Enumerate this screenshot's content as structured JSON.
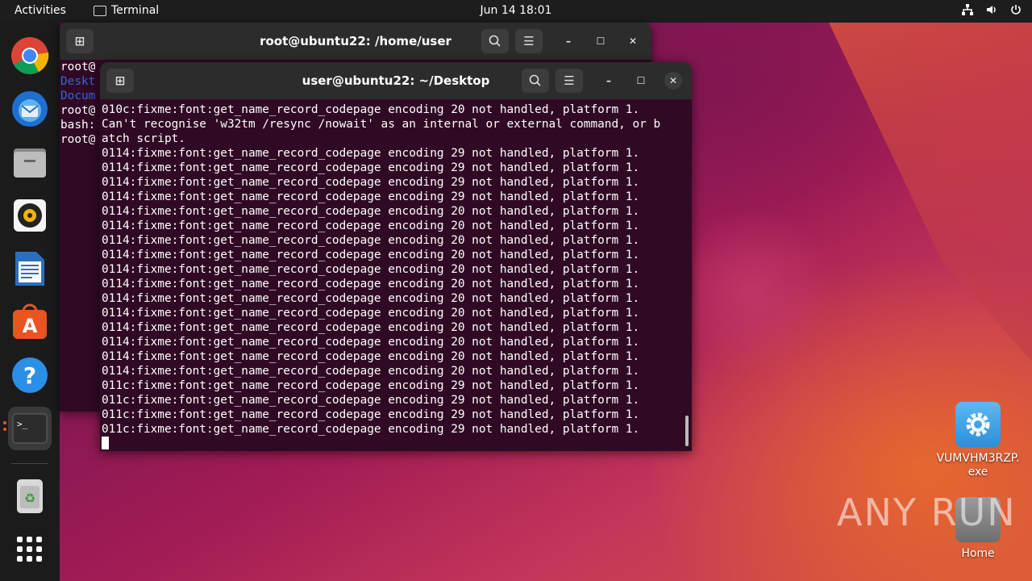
{
  "topbar": {
    "activities": "Activities",
    "app_name": "Terminal",
    "clock": "Jun 14  18:01",
    "tray_icons": [
      "network-icon",
      "volume-icon",
      "power-icon"
    ]
  },
  "dock": {
    "items": [
      "chrome-icon",
      "thunderbird-icon",
      "files-icon",
      "rhythmbox-icon",
      "writer-icon",
      "app-center-icon",
      "help-icon",
      "terminal-icon",
      "trash-icon",
      "show-apps-icon"
    ]
  },
  "back_window": {
    "title": "root@ubuntu22: /home/user",
    "lines": [
      {
        "text": "root@",
        "color": "#ffffff"
      },
      {
        "text": "Deskt",
        "color": "#3465d4"
      },
      {
        "text": "Docum",
        "color": "#3465d4"
      },
      {
        "text": "root@",
        "color": "#ffffff"
      },
      {
        "text": "bash:",
        "color": "#ffffff"
      },
      {
        "text": "root@",
        "color": "#ffffff"
      }
    ]
  },
  "front_window": {
    "title": "user@ubuntu22: ~/Desktop",
    "lines": [
      "010c:fixme:font:get_name_record_codepage encoding 20 not handled, platform 1.",
      "Can't recognise 'w32tm /resync /nowait' as an internal or external command, or b",
      "atch script.",
      "0114:fixme:font:get_name_record_codepage encoding 29 not handled, platform 1.",
      "0114:fixme:font:get_name_record_codepage encoding 29 not handled, platform 1.",
      "0114:fixme:font:get_name_record_codepage encoding 29 not handled, platform 1.",
      "0114:fixme:font:get_name_record_codepage encoding 29 not handled, platform 1.",
      "0114:fixme:font:get_name_record_codepage encoding 20 not handled, platform 1.",
      "0114:fixme:font:get_name_record_codepage encoding 20 not handled, platform 1.",
      "0114:fixme:font:get_name_record_codepage encoding 20 not handled, platform 1.",
      "0114:fixme:font:get_name_record_codepage encoding 20 not handled, platform 1.",
      "0114:fixme:font:get_name_record_codepage encoding 20 not handled, platform 1.",
      "0114:fixme:font:get_name_record_codepage encoding 20 not handled, platform 1.",
      "0114:fixme:font:get_name_record_codepage encoding 20 not handled, platform 1.",
      "0114:fixme:font:get_name_record_codepage encoding 20 not handled, platform 1.",
      "0114:fixme:font:get_name_record_codepage encoding 20 not handled, platform 1.",
      "0114:fixme:font:get_name_record_codepage encoding 20 not handled, platform 1.",
      "0114:fixme:font:get_name_record_codepage encoding 20 not handled, platform 1.",
      "0114:fixme:font:get_name_record_codepage encoding 20 not handled, platform 1.",
      "011c:fixme:font:get_name_record_codepage encoding 29 not handled, platform 1.",
      "011c:fixme:font:get_name_record_codepage encoding 29 not handled, platform 1.",
      "011c:fixme:font:get_name_record_codepage encoding 29 not handled, platform 1.",
      "011c:fixme:font:get_name_record_codepage encoding 29 not handled, platform 1."
    ]
  },
  "desktop": {
    "icons": [
      {
        "label": "VUMVHM3RZP.\nexe",
        "icon": "settings-gear-icon"
      },
      {
        "label": "Home",
        "icon": "home-folder-icon"
      }
    ],
    "watermark": "ANY RUN"
  },
  "colors": {
    "terminal_bg": "#300a24",
    "accent": "#e95420",
    "titlebar": "#2c2c2c"
  }
}
